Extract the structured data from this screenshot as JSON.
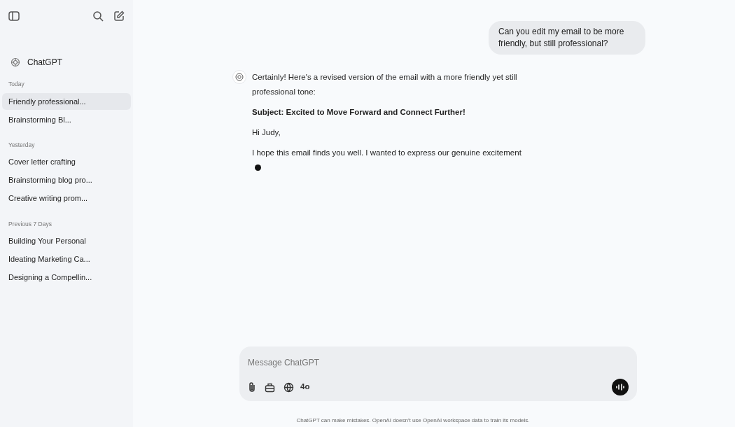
{
  "sidebar": {
    "brand": "ChatGPT",
    "sections": [
      {
        "label": "Today",
        "items": [
          {
            "label": "Friendly professional...",
            "selected": true
          },
          {
            "label": "Brainstorming Bl...",
            "selected": false
          }
        ]
      },
      {
        "label": "Yesterday",
        "items": [
          {
            "label": "Cover letter crafting",
            "selected": false
          },
          {
            "label": "Brainstorming blog pro...",
            "selected": false
          },
          {
            "label": "Creative writing prom...",
            "selected": false
          }
        ]
      },
      {
        "label": "Previous 7 Days",
        "items": [
          {
            "label": "Building Your Personal",
            "selected": false
          },
          {
            "label": "Ideating Marketing Ca...",
            "selected": false
          },
          {
            "label": "Designing a Compellin...",
            "selected": false
          }
        ]
      }
    ]
  },
  "conversation": {
    "user_message": "Can you edit my email to be more friendly, but still professional?",
    "reply": {
      "streaming": true,
      "paragraphs": [
        {
          "kind": "text",
          "text": "Certainly! Here's a revised version of the email with a more friendly yet still professional tone:"
        },
        {
          "kind": "heading",
          "text": "Subject: Excited to Move Forward and Connect Further!"
        },
        {
          "kind": "text",
          "text": "Hi Judy,"
        },
        {
          "kind": "text",
          "text": "I hope this email finds you well. I wanted to express our genuine excitement"
        }
      ]
    }
  },
  "composer": {
    "placeholder": "Message ChatGPT",
    "model": "4o"
  },
  "footer": "ChatGPT can make mistakes. OpenAI doesn't use OpenAI workspace data to train its models."
}
